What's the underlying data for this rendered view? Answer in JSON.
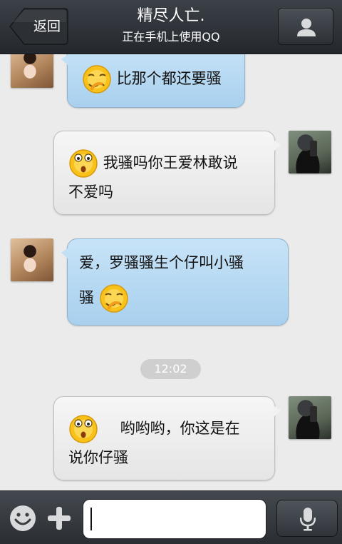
{
  "header": {
    "back_label": "返回",
    "contact_name": "精尽人亡.",
    "contact_status": "正在手机上使用QQ"
  },
  "messages": [
    {
      "side": "incoming",
      "text": "比那个都还要骚",
      "emoji": "shy-blush"
    },
    {
      "side": "outgoing",
      "text": "我骚吗你王爱林敢说不爱吗",
      "emoji": "surprised"
    },
    {
      "side": "incoming",
      "text": "爱，罗骚骚生个仔叫小骚骚",
      "emoji": "shy-blush"
    },
    {
      "side": "outgoing",
      "text": "哟哟哟，你这是在说你仔骚",
      "emoji": "surprised"
    }
  ],
  "msg1": {
    "text": "比那个都还要骚"
  },
  "msg2": {
    "line1": "我骚吗你王爱林敢说",
    "line2": "不爱吗"
  },
  "msg3": {
    "line1": "爱，罗骚骚生个仔叫小骚",
    "line2": "骚"
  },
  "timestamp": "12:02",
  "msg4": {
    "line1": "哟哟哟，你这是在",
    "line2": "说你仔骚"
  },
  "input": {
    "value": "",
    "placeholder": ""
  },
  "icons": {
    "back": "back-arrow-icon",
    "profile": "person-icon",
    "emoji": "smiley-icon",
    "plus": "plus-icon",
    "voice": "microphone-icon"
  },
  "colors": {
    "header_bg": "#2f3439",
    "incoming_bubble": "#b8daf3",
    "outgoing_bubble": "#eeeeee",
    "chat_bg": "#ebebeb",
    "timestamp_pill": "#cfcfcf"
  }
}
